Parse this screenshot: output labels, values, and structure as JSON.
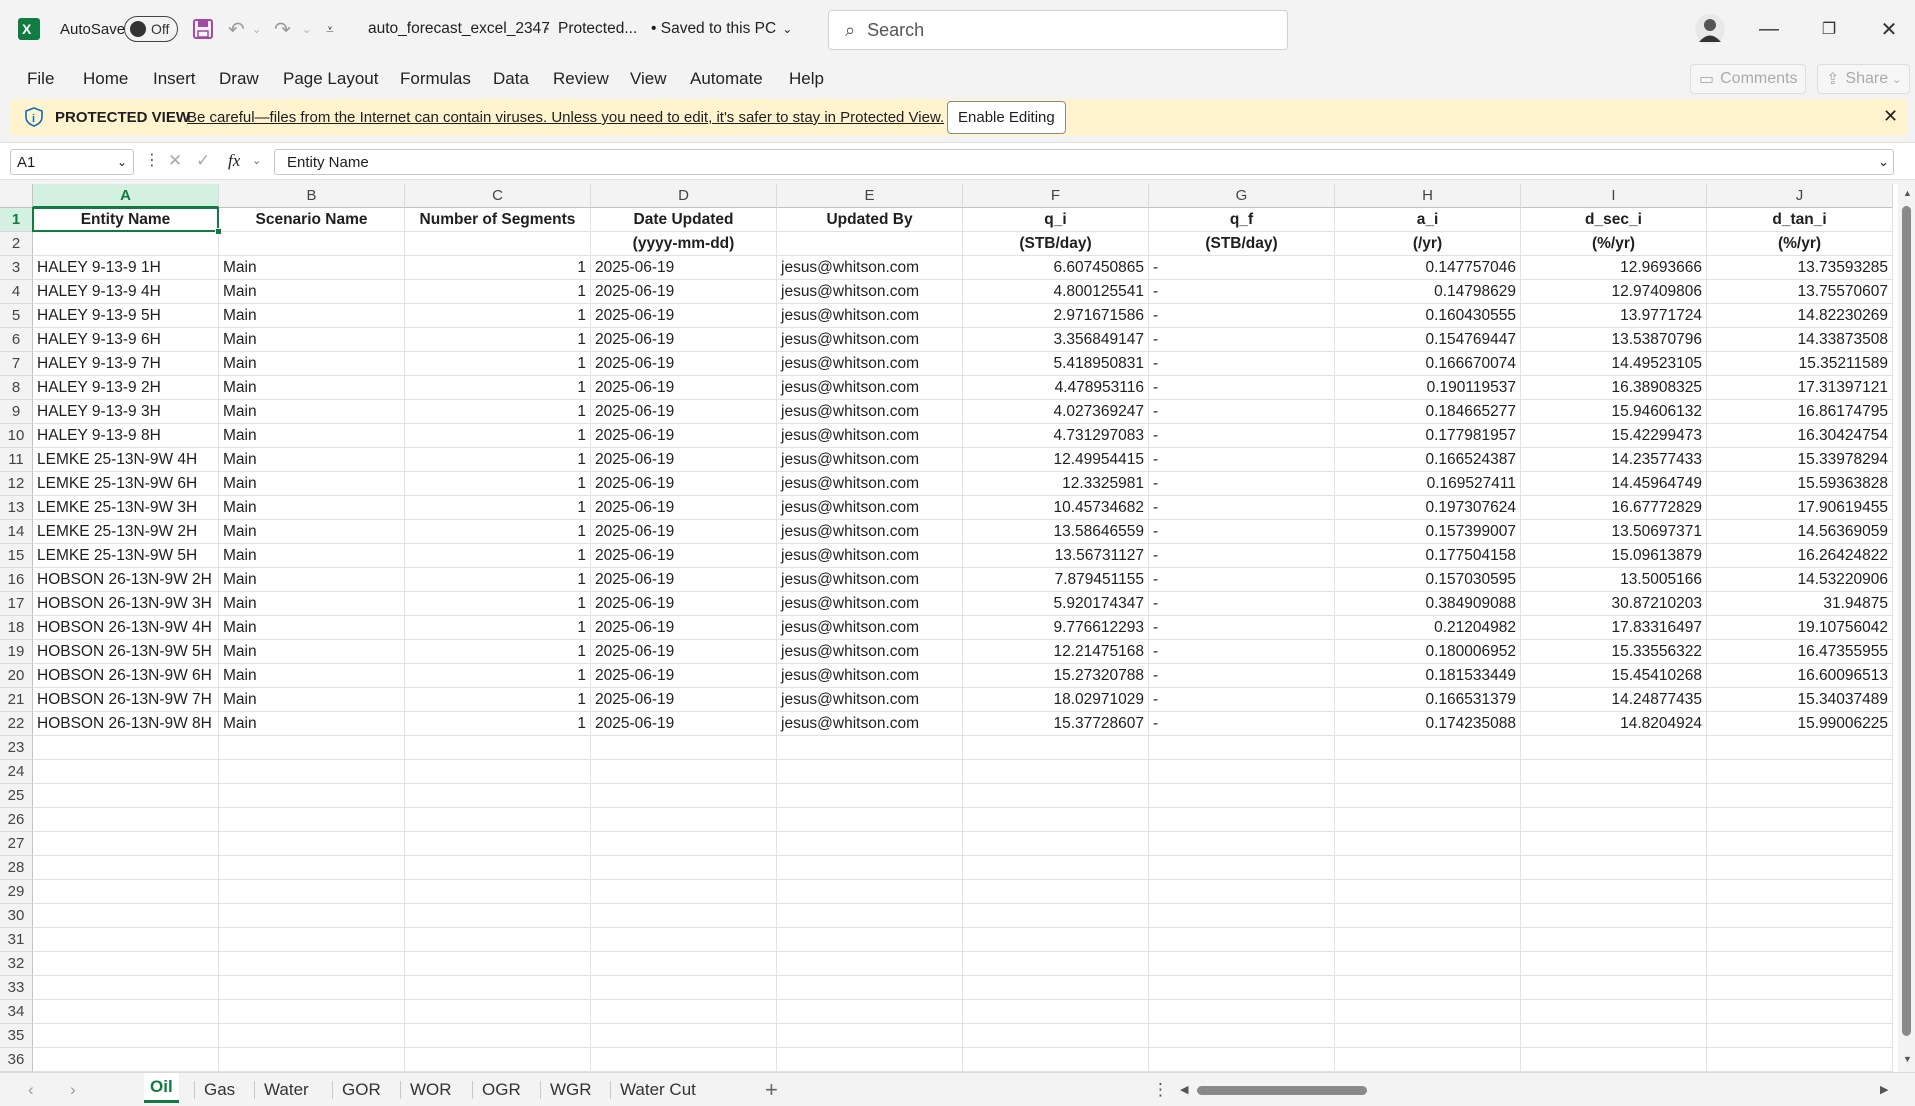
{
  "titlebar": {
    "autosave_label": "AutoSave",
    "autosave_state": "Off",
    "file_name": "auto_forecast_excel_2347",
    "separator": "-",
    "file_status": "Protected...",
    "saved_status": "• Saved to this PC",
    "search_placeholder": "Search"
  },
  "menu": [
    "File",
    "Home",
    "Insert",
    "Draw",
    "Page Layout",
    "Formulas",
    "Data",
    "Review",
    "View",
    "Automate",
    "Help"
  ],
  "ribbon_right": {
    "comments": "Comments",
    "share": "Share"
  },
  "protected_view": {
    "label": "PROTECTED VIEW",
    "message": "Be careful—files from the Internet can contain viruses. Unless you need to edit, it's safer to stay in Protected View.",
    "button": "Enable Editing"
  },
  "formula_bar": {
    "name_box": "A1",
    "fx": "fx",
    "content": "Entity Name"
  },
  "columns": [
    "A",
    "B",
    "C",
    "D",
    "E",
    "F",
    "G",
    "H",
    "I",
    "J"
  ],
  "header_row1": [
    "Entity Name",
    "Scenario Name",
    "Number of Segments",
    "Date Updated",
    "Updated By",
    "q_i",
    "q_f",
    "a_i",
    "d_sec_i",
    "d_tan_i"
  ],
  "header_row2": [
    "",
    "",
    "",
    "(yyyy-mm-dd)",
    "",
    "(STB/day)",
    "(STB/day)",
    "(/yr)",
    "(%/yr)",
    "(%/yr)"
  ],
  "rows": [
    [
      "HALEY 9-13-9 1H",
      "Main",
      "1",
      "2025-06-19",
      "jesus@whitson.com",
      "6.607450865",
      "-",
      "0.147757046",
      "12.9693666",
      "13.73593285"
    ],
    [
      "HALEY 9-13-9 4H",
      "Main",
      "1",
      "2025-06-19",
      "jesus@whitson.com",
      "4.800125541",
      "-",
      "0.14798629",
      "12.97409806",
      "13.75570607"
    ],
    [
      "HALEY 9-13-9 5H",
      "Main",
      "1",
      "2025-06-19",
      "jesus@whitson.com",
      "2.971671586",
      "-",
      "0.160430555",
      "13.9771724",
      "14.82230269"
    ],
    [
      "HALEY 9-13-9 6H",
      "Main",
      "1",
      "2025-06-19",
      "jesus@whitson.com",
      "3.356849147",
      "-",
      "0.154769447",
      "13.53870796",
      "14.33873508"
    ],
    [
      "HALEY 9-13-9 7H",
      "Main",
      "1",
      "2025-06-19",
      "jesus@whitson.com",
      "5.418950831",
      "-",
      "0.166670074",
      "14.49523105",
      "15.35211589"
    ],
    [
      "HALEY 9-13-9 2H",
      "Main",
      "1",
      "2025-06-19",
      "jesus@whitson.com",
      "4.478953116",
      "-",
      "0.190119537",
      "16.38908325",
      "17.31397121"
    ],
    [
      "HALEY 9-13-9 3H",
      "Main",
      "1",
      "2025-06-19",
      "jesus@whitson.com",
      "4.027369247",
      "-",
      "0.184665277",
      "15.94606132",
      "16.86174795"
    ],
    [
      "HALEY 9-13-9 8H",
      "Main",
      "1",
      "2025-06-19",
      "jesus@whitson.com",
      "4.731297083",
      "-",
      "0.177981957",
      "15.42299473",
      "16.30424754"
    ],
    [
      "LEMKE 25-13N-9W 4H",
      "Main",
      "1",
      "2025-06-19",
      "jesus@whitson.com",
      "12.49954415",
      "-",
      "0.166524387",
      "14.23577433",
      "15.33978294"
    ],
    [
      "LEMKE 25-13N-9W 6H",
      "Main",
      "1",
      "2025-06-19",
      "jesus@whitson.com",
      "12.3325981",
      "-",
      "0.169527411",
      "14.45964749",
      "15.59363828"
    ],
    [
      "LEMKE 25-13N-9W 3H",
      "Main",
      "1",
      "2025-06-19",
      "jesus@whitson.com",
      "10.45734682",
      "-",
      "0.197307624",
      "16.67772829",
      "17.90619455"
    ],
    [
      "LEMKE 25-13N-9W 2H",
      "Main",
      "1",
      "2025-06-19",
      "jesus@whitson.com",
      "13.58646559",
      "-",
      "0.157399007",
      "13.50697371",
      "14.56369059"
    ],
    [
      "LEMKE 25-13N-9W 5H",
      "Main",
      "1",
      "2025-06-19",
      "jesus@whitson.com",
      "13.56731127",
      "-",
      "0.177504158",
      "15.09613879",
      "16.26424822"
    ],
    [
      "HOBSON 26-13N-9W 2H",
      "Main",
      "1",
      "2025-06-19",
      "jesus@whitson.com",
      "7.879451155",
      "-",
      "0.157030595",
      "13.5005166",
      "14.53220906"
    ],
    [
      "HOBSON 26-13N-9W 3H",
      "Main",
      "1",
      "2025-06-19",
      "jesus@whitson.com",
      "5.920174347",
      "-",
      "0.384909088",
      "30.87210203",
      "31.94875"
    ],
    [
      "HOBSON 26-13N-9W 4H",
      "Main",
      "1",
      "2025-06-19",
      "jesus@whitson.com",
      "9.776612293",
      "-",
      "0.21204982",
      "17.83316497",
      "19.10756042"
    ],
    [
      "HOBSON 26-13N-9W 5H",
      "Main",
      "1",
      "2025-06-19",
      "jesus@whitson.com",
      "12.21475168",
      "-",
      "0.180006952",
      "15.33556322",
      "16.47355955"
    ],
    [
      "HOBSON 26-13N-9W 6H",
      "Main",
      "1",
      "2025-06-19",
      "jesus@whitson.com",
      "15.27320788",
      "-",
      "0.181533449",
      "15.45410268",
      "16.60096513"
    ],
    [
      "HOBSON 26-13N-9W 7H",
      "Main",
      "1",
      "2025-06-19",
      "jesus@whitson.com",
      "18.02971029",
      "-",
      "0.166531379",
      "14.24877435",
      "15.34037489"
    ],
    [
      "HOBSON 26-13N-9W 8H",
      "Main",
      "1",
      "2025-06-19",
      "jesus@whitson.com",
      "15.37728607",
      "-",
      "0.174235088",
      "14.8204924",
      "15.99006225"
    ]
  ],
  "row_count": 36,
  "sheet_tabs": [
    "Oil",
    "Gas",
    "Water",
    "GOR",
    "WOR",
    "OGR",
    "WGR",
    "Water Cut"
  ],
  "active_tab": "Oil",
  "colors": {
    "excel_green": "#107c41",
    "protected_bg": "#fff4ce",
    "save_purple": "#a349a4"
  }
}
